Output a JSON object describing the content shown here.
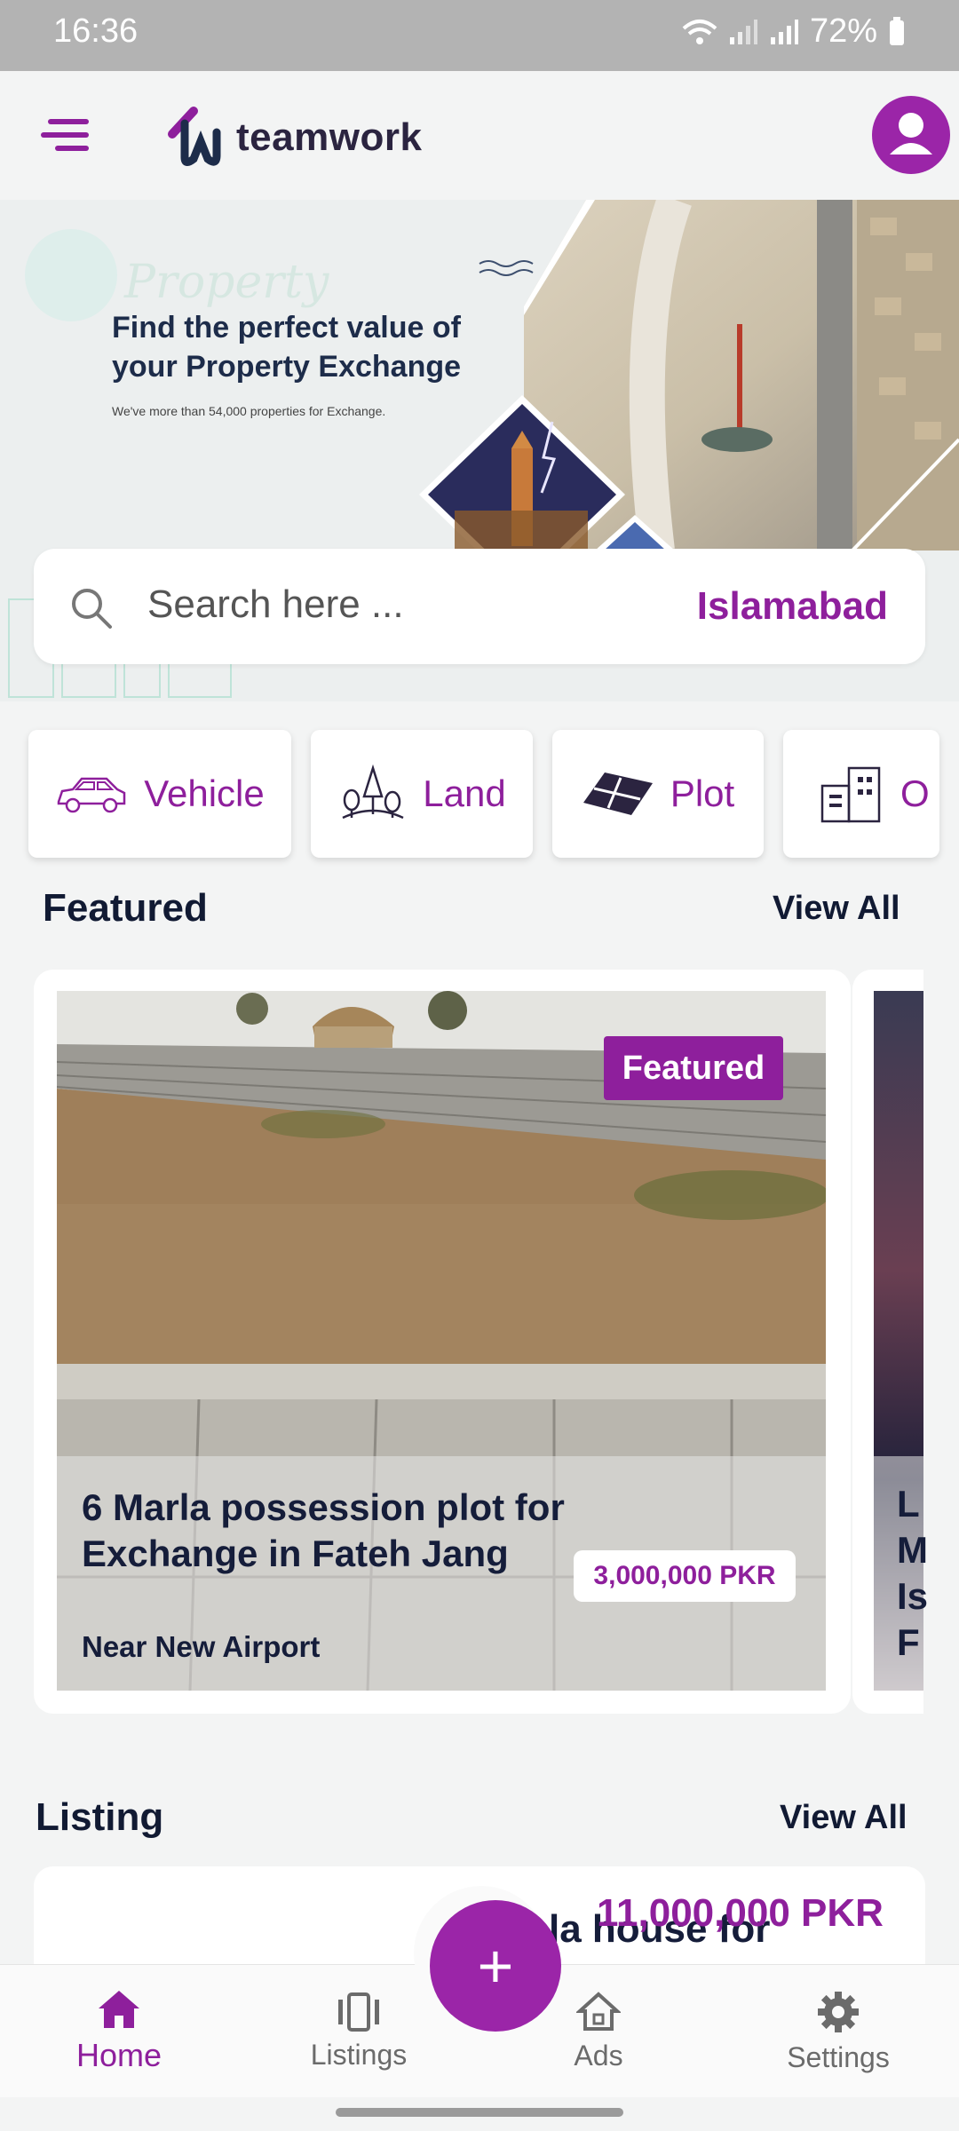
{
  "status": {
    "time": "16:36",
    "battery": "72%"
  },
  "header": {
    "brand": "teamwork"
  },
  "banner": {
    "title": "Find the perfect value of your Property Exchange",
    "subtitle": "We've more than 54,000 properties for Exchange."
  },
  "search": {
    "placeholder": "Search here ...",
    "city": "Islamabad"
  },
  "categories": [
    {
      "label": "Vehicle",
      "icon": "car-icon"
    },
    {
      "label": "Land",
      "icon": "trees-icon"
    },
    {
      "label": "Plot",
      "icon": "plot-icon"
    },
    {
      "label": "O",
      "icon": "building-icon"
    }
  ],
  "featured": {
    "title": "Featured",
    "view_all": "View All",
    "badge": "Featured",
    "card": {
      "title": "6 Marla possession plot for Exchange in Fateh Jang",
      "subtitle": "Near New Airport",
      "price": "3,000,000 PKR"
    },
    "next_card_letters": "L\nM\nIs\nF"
  },
  "listing": {
    "title": "Listing",
    "view_all": "View All",
    "card": {
      "price": "11,000,000 PKR",
      "title_fragment": "la house for"
    }
  },
  "nav": {
    "home": "Home",
    "listings": "Listings",
    "ads": "Ads",
    "settings": "Settings",
    "fab": "+"
  },
  "colors": {
    "accent": "#8e1f9c",
    "fab": "#9b25a8",
    "dark_text": "#151d3a"
  }
}
